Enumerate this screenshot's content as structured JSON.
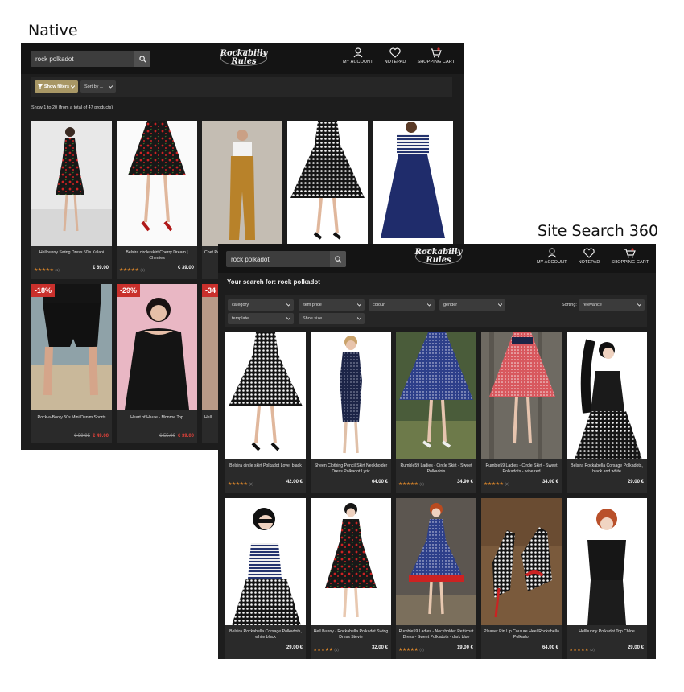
{
  "captions": {
    "native": "Native",
    "site_search": "Site Search 360"
  },
  "colors": {
    "accent_gold": "#a89765",
    "star": "#d3822a",
    "sale": "#c9302c",
    "dark_bg": "#1d1d1d"
  },
  "header": {
    "logo": "Rockabilly Rules",
    "nav": [
      {
        "label": "MY ACCOUNT",
        "icon": "user-icon"
      },
      {
        "label": "NOTEPAD",
        "icon": "heart-icon"
      },
      {
        "label": "SHOPPING CART",
        "icon": "cart-icon"
      }
    ]
  },
  "native": {
    "search_value": "rock polkadot",
    "show_filters": "Show filters",
    "sort_placeholder": "Sort by ...",
    "result_count": "Show 1 to 20 (from a total of 47 products)",
    "products": [
      {
        "name": "Hellbunny Swing Dress 50's Kalani",
        "stars": "★★★★★",
        "reviews": "(1)",
        "price": "€ 69.00",
        "old_price": "",
        "discount": ""
      },
      {
        "name": "Belsira circle skirt Cherry Dream | Cherries",
        "stars": "★★★★★",
        "reviews": "(5)",
        "price": "€ 39.00",
        "old_price": "",
        "discount": ""
      },
      {
        "name": "Chet Rock Dungaree...",
        "stars": "",
        "reviews": "",
        "price": "",
        "old_price": "",
        "discount": ""
      },
      {
        "name": "",
        "stars": "",
        "reviews": "",
        "price": "",
        "old_price": "",
        "discount": ""
      },
      {
        "name": "",
        "stars": "",
        "reviews": "",
        "price": "",
        "old_price": "",
        "discount": ""
      },
      {
        "name": "Rock-a-Booty 50s Mini Denim Shorts",
        "stars": "",
        "reviews": "",
        "price": "€ 49.00",
        "old_price": "€ 59.95",
        "discount": "-18%"
      },
      {
        "name": "Heart of Haute - Monroe Top",
        "stars": "",
        "reviews": "",
        "price": "€ 39.00",
        "old_price": "€ 55.00",
        "discount": "-29%"
      },
      {
        "name": "Hell...",
        "stars": "",
        "reviews": "",
        "price": "",
        "old_price": "",
        "discount": "-34"
      }
    ]
  },
  "site_search": {
    "search_value": "rock polkadot",
    "heading": "Your search for: rock polkadot",
    "filters": [
      "category",
      "item price",
      "colour",
      "gender",
      "template",
      "Shoe size"
    ],
    "sorting_label": "Sorting:",
    "sorting_value": "relevance",
    "products": [
      {
        "name": "Belsira circle skirt Polkadot Love, black",
        "stars": "★★★★★",
        "reviews": "(2)",
        "price": "42.00 €"
      },
      {
        "name": "Sheen Clothing Pencil Skirt Neckholder Dress Polkadot Lyric",
        "stars": "",
        "reviews": "",
        "price": "64.00 €"
      },
      {
        "name": "Rumble59 Ladies - Circle Skirt - Sweet Polkadots",
        "stars": "★★★★★",
        "reviews": "(3)",
        "price": "34.90 €"
      },
      {
        "name": "Rumble59 Ladies - Circle Skirt - Sweet Polkadots - wine red",
        "stars": "★★★★★",
        "reviews": "(2)",
        "price": "34.00 €"
      },
      {
        "name": "Belsira Rockabella Corsage Polkadots, black and white",
        "stars": "",
        "reviews": "",
        "price": "29.00 €"
      },
      {
        "name": "Belsira Rockabella Corsage Polkadots, white black",
        "stars": "",
        "reviews": "",
        "price": "29.00 €"
      },
      {
        "name": "Hell Bunny - Rockabella Polkadot Swing Dress Stevie",
        "stars": "★★★★★",
        "reviews": "(1)",
        "price": "32.00 €"
      },
      {
        "name": "Rumble59 Ladies - Neckholder Petticoat Dress - Sweet Polkadots - dark blue",
        "stars": "★★★★★",
        "reviews": "(4)",
        "price": "19.00 €"
      },
      {
        "name": "Pleaser Pin Up Couture Heel Rockabella Polkadot",
        "stars": "",
        "reviews": "",
        "price": "64.00 €"
      },
      {
        "name": "Hellbunny Polkadot Top Chloe",
        "stars": "★★★★★",
        "reviews": "(2)",
        "price": "29.00 €"
      }
    ]
  }
}
